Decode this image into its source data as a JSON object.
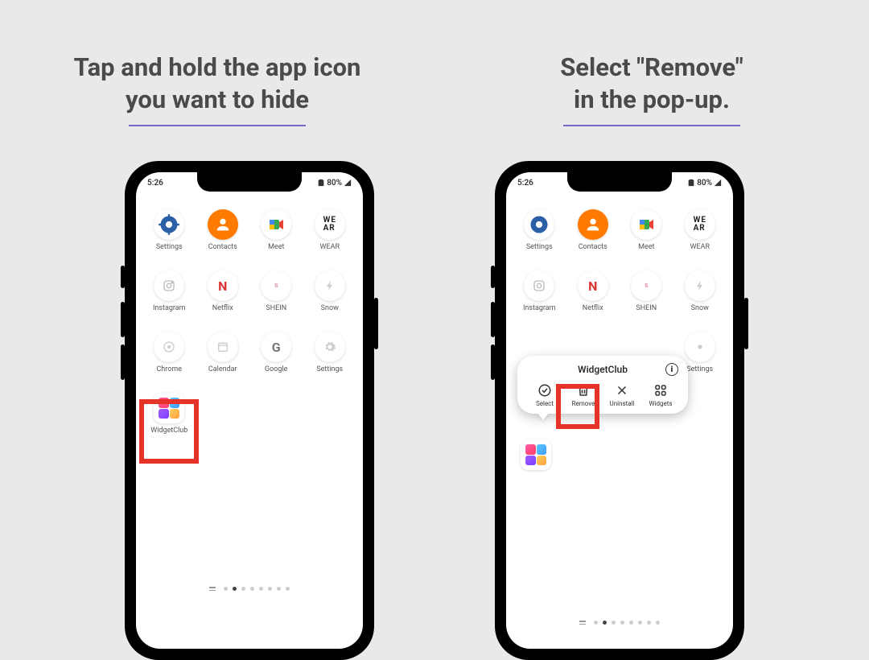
{
  "captions": {
    "left_line1": "Tap and hold the app icon",
    "left_line2": "you want to hide",
    "right_line1": "Select \"Remove\"",
    "right_line2": "in the pop-up."
  },
  "status": {
    "time": "5:26",
    "battery": "80%"
  },
  "apps_row1": [
    {
      "label": "Settings"
    },
    {
      "label": "Contacts"
    },
    {
      "label": "Meet"
    },
    {
      "label": "WEAR"
    }
  ],
  "apps_row2": [
    {
      "label": "Instagram"
    },
    {
      "label": "Netflix"
    },
    {
      "label": "SHEIN"
    },
    {
      "label": "Snow"
    }
  ],
  "apps_row3": [
    {
      "label": "Chrome"
    },
    {
      "label": "Calendar"
    },
    {
      "label": "Google"
    },
    {
      "label": "Settings"
    }
  ],
  "widgetclub_label": "WidgetClub",
  "popup": {
    "title": "WidgetClub",
    "actions": {
      "select": "Select",
      "remove": "Remove",
      "uninstall": "Uninstall",
      "widgets": "Widgets"
    }
  },
  "right_extra_app": "Settings",
  "page_dots_count": 8,
  "active_dot_index": 1
}
